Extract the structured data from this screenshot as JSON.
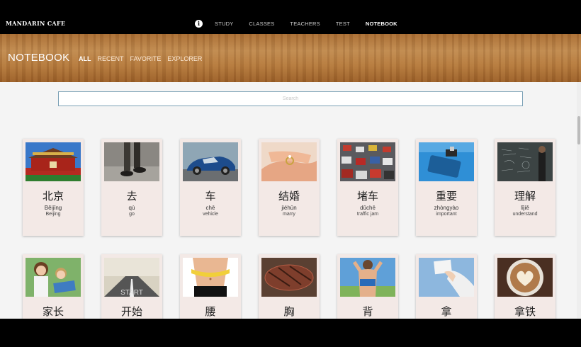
{
  "brand": "MANDARIN CAFE",
  "nav": {
    "info_icon": "info-icon",
    "links": [
      "STUDY",
      "CLASSES",
      "TEACHERS",
      "TEST",
      "NOTEBOOK"
    ],
    "active": "NOTEBOOK"
  },
  "header": {
    "title": "NOTEBOOK",
    "tabs": [
      "ALL",
      "RECENT",
      "FAVORITE",
      "EXPLORER"
    ],
    "active_tab": "ALL"
  },
  "search": {
    "placeholder": "Search",
    "value": ""
  },
  "cards": [
    {
      "hanzi": "北京",
      "pinyin": "Běijīng",
      "meaning": "Beijing",
      "image": "beijing-gate-image"
    },
    {
      "hanzi": "去",
      "pinyin": "qù",
      "meaning": "go",
      "image": "walking-legs-image"
    },
    {
      "hanzi": "车",
      "pinyin": "chē",
      "meaning": "vehicle",
      "image": "sports-car-image"
    },
    {
      "hanzi": "结婚",
      "pinyin": "jiéhūn",
      "meaning": "marry",
      "image": "wedding-ring-image"
    },
    {
      "hanzi": "堵车",
      "pinyin": "dǔchē",
      "meaning": "traffic jam",
      "image": "traffic-jam-image"
    },
    {
      "hanzi": "重要",
      "pinyin": "zhòngyào",
      "meaning": "important",
      "image": "important-key-image"
    },
    {
      "hanzi": "理解",
      "pinyin": "lǐjiě",
      "meaning": "understand",
      "image": "chalkboard-image"
    },
    {
      "hanzi": "家长",
      "pinyin": "",
      "meaning": "",
      "image": "parent-child-image"
    },
    {
      "hanzi": "开始",
      "pinyin": "",
      "meaning": "",
      "image": "road-start-image"
    },
    {
      "hanzi": "腰",
      "pinyin": "",
      "meaning": "",
      "image": "waist-tape-image"
    },
    {
      "hanzi": "胸",
      "pinyin": "",
      "meaning": "",
      "image": "steak-image"
    },
    {
      "hanzi": "背",
      "pinyin": "",
      "meaning": "",
      "image": "back-image"
    },
    {
      "hanzi": "拿",
      "pinyin": "",
      "meaning": "",
      "image": "hand-card-image"
    },
    {
      "hanzi": "拿铁",
      "pinyin": "",
      "meaning": "",
      "image": "latte-image"
    }
  ]
}
